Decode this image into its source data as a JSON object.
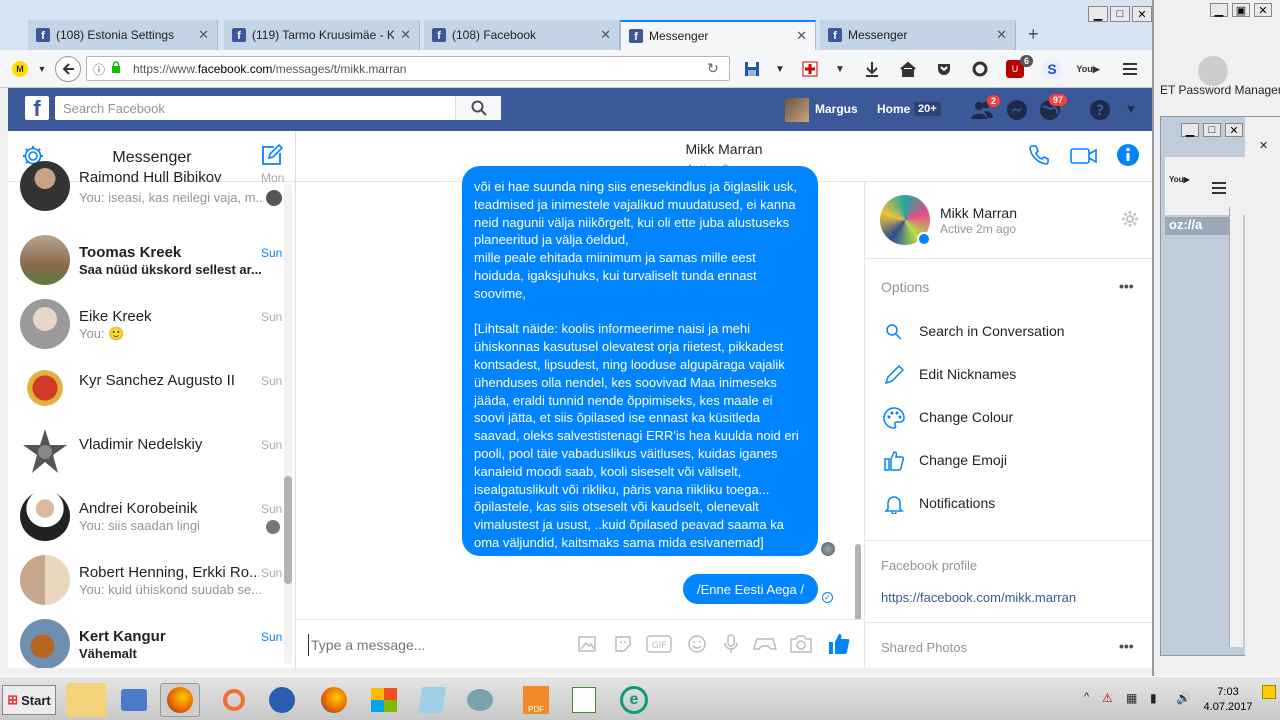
{
  "browser": {
    "tabs": [
      {
        "label": "(108) Estonia Settings"
      },
      {
        "label": "(119) Tarmo Kruusimäe - K"
      },
      {
        "label": "(108) Facebook"
      },
      {
        "label": "Messenger"
      },
      {
        "label": "Messenger"
      }
    ],
    "url_prefix": "https://www.",
    "url_domain": "facebook.com",
    "url_path": "/messages/t/mikk.marran",
    "extension_badge": "6"
  },
  "fb_header": {
    "search_placeholder": "Search Facebook",
    "user_name": "Margus",
    "home_label": "Home",
    "home_count": "20+",
    "friend_requests_count": "2",
    "notifications_count": "97"
  },
  "messenger": {
    "title": "Messenger",
    "conversations": [
      {
        "name": "Raimond Hull Bibikov",
        "snippet": "You: iseasi, kas neilegi vaja, m...",
        "date": "Mon",
        "unread": false
      },
      {
        "name": "Toomas Kreek",
        "snippet": "Saa nüüd ükskord sellest ar...",
        "date": "Sun",
        "unread": true
      },
      {
        "name": "Eike Kreek",
        "snippet": "You: 🙂",
        "date": "Sun",
        "unread": false
      },
      {
        "name": "Kyr Sanchez Augusto II",
        "snippet": "",
        "date": "Sun",
        "unread": false
      },
      {
        "name": "Vladimir Nedelskiy",
        "snippet": "",
        "date": "Sun",
        "unread": false
      },
      {
        "name": "Andrei Korobeinik",
        "snippet": "You: siis saadan lingi",
        "date": "Sun",
        "unread": false
      },
      {
        "name": "Robert Henning, Erkki Ro...",
        "snippet": "You: kuid ühiskond suudab se...",
        "date": "Sun",
        "unread": false
      },
      {
        "name": "Kert Kangur",
        "snippet": "Vähemalt",
        "date": "Sun",
        "unread": true
      }
    ]
  },
  "chat": {
    "name": "Mikk Marran",
    "status": "Active 2m ago",
    "message_long": "või ei hae suunda ning siis enesekindlus ja õiglaslik usk, teadmised ja inimestele vajalikud muudatused, ei kanna neid nagunii välja niikõrgelt, kui oli ette juba alustuseks planeeritud ja välja öeldud,\nmille peale ehitada miinimum ja samas mille eest hoiduda, igaksjuhuks, kui turvaliselt tunda ennast soovime,\n\n[Lihtsalt näide: koolis informeerime naisi ja mehi ühiskonnas kasutusel olevatest orja riietest, pikkadest kontsadest, lipsudest, ning looduse algupäraga vajalik ühenduses olla nendel, kes soovivad Maa inimeseks jääda, eraldi tunnid nende õppimiseks, kes maale ei soovi jätta, et siis õpilased ise ennast ka küsitleda saavad, oleks salvestistenagi ERR'is hea kuulda noid eri pooli, pool täie vabaduslikus väitluses, kuidas iganes kanaleid moodi saab, kooli siseselt või väliselt, isealgatuslikult või rikliku, päris vana riikliku toega... õpilastele, kas siis otseselt või kaudselt, olenevalt vimalustest ja usust, ..kuid õpilased peavad saama ka oma väljundid, kaitsmaks sama mida esivanemad]",
    "message_short": "/Enne Eesti Aega /",
    "input_placeholder": "Type a message..."
  },
  "details": {
    "name": "Mikk Marran",
    "status": "Active 2m ago",
    "options_label": "Options",
    "options": [
      {
        "label": "Search in Conversation",
        "icon": "search-icon"
      },
      {
        "label": "Edit Nicknames",
        "icon": "pencil-icon"
      },
      {
        "label": "Change Colour",
        "icon": "palette-icon"
      },
      {
        "label": "Change Emoji",
        "icon": "thumbs-up-icon"
      },
      {
        "label": "Notifications",
        "icon": "bell-icon"
      }
    ],
    "profile_label": "Facebook profile",
    "profile_link": "https://facebook.com/mikk.marran",
    "shared_photos_label": "Shared Photos"
  },
  "side_window": {
    "title": "ET Password Manager",
    "url_fragment": "oz://a"
  },
  "taskbar": {
    "start_label": "Start",
    "time": "7:03",
    "date": "4.07.2017"
  },
  "colors": {
    "fb_blue": "#3b5998",
    "messenger_blue": "#0084ff"
  }
}
